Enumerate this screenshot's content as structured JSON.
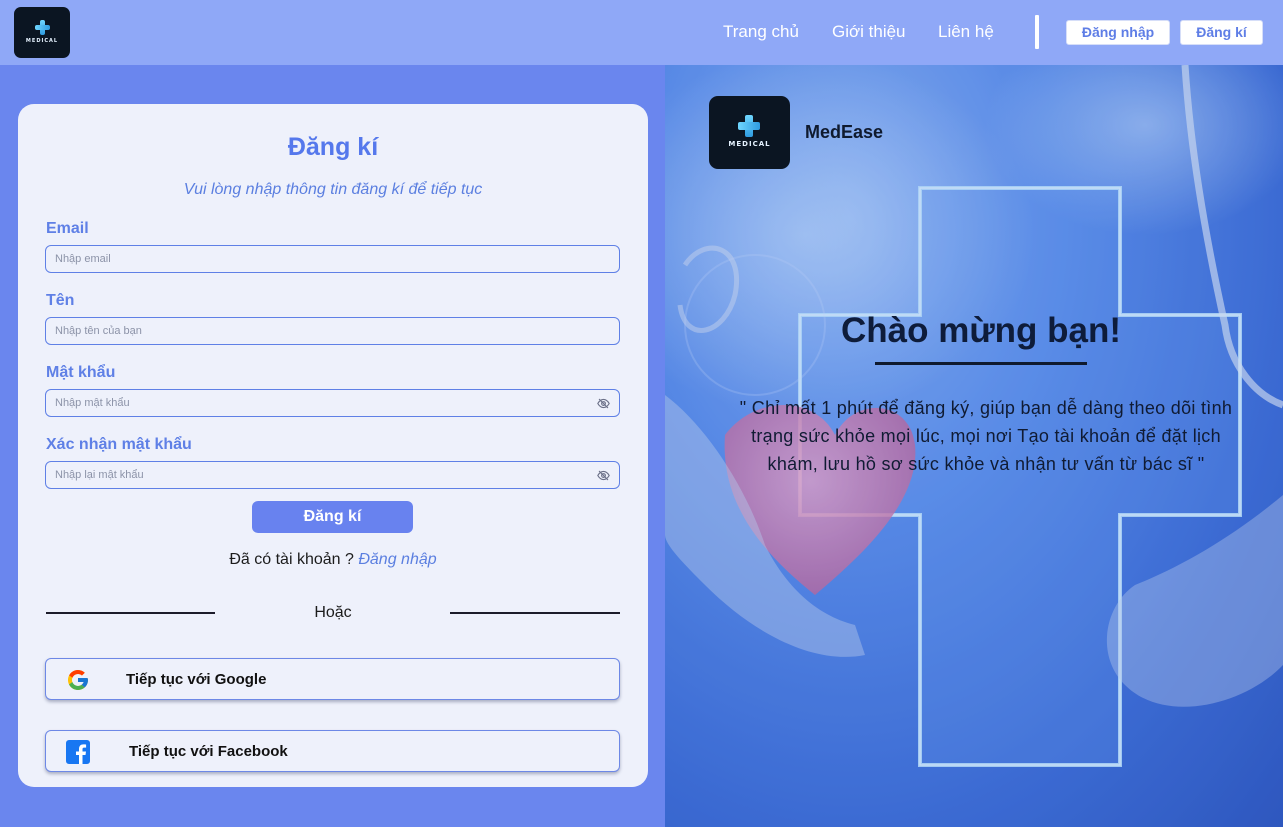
{
  "nav": {
    "logo_text": "MEDICAL",
    "links": [
      "Trang chủ",
      "Giới thiệu",
      "Liên hệ"
    ],
    "login_button": "Đăng nhập",
    "register_button": "Đăng kí"
  },
  "form": {
    "title": "Đăng kí",
    "subtitle": "Vui lòng nhập thông tin đăng kí để tiếp tục",
    "fields": [
      {
        "label": "Email",
        "placeholder": "Nhập email",
        "value": ""
      },
      {
        "label": "Tên",
        "placeholder": "Nhập tên của bạn",
        "value": ""
      },
      {
        "label": "Mật khẩu",
        "placeholder": "Nhập mật khẩu",
        "value": ""
      },
      {
        "label": "Xác nhận mật khẩu",
        "placeholder": "Nhập lại mật khẩu",
        "value": ""
      }
    ],
    "submit_label": "Đăng kí",
    "have_account_text": "Đã có tài khoản ?",
    "login_link": "Đăng nhập",
    "or_text": "Hoặc",
    "google_label": "Tiếp tục với Google",
    "facebook_label": "Tiếp tục với Facebook"
  },
  "hero": {
    "logo_text": "MEDICAL",
    "brand_name": "MedEase",
    "title": "Chào mừng bạn!",
    "quote": "\" Chỉ mất 1 phút để đăng ký, giúp bạn dễ dàng theo dõi tình trạng sức khỏe mọi lúc, mọi nơi Tạo tài khoản để đặt lịch khám, lưu hồ sơ sức khỏe và nhận tư vấn từ bác sĩ \""
  },
  "colors": {
    "navbar": "#8fa8f7",
    "page_background": "#6a86ee",
    "card": "#eef1fb",
    "accent": "#5f80e6",
    "submit_button": "#6882ef",
    "facebook": "#1877f2"
  },
  "icons": {
    "logo": "medical-cross-icon",
    "password_toggle": "eye-slash-icon",
    "google": "google-icon",
    "facebook": "facebook-icon"
  }
}
